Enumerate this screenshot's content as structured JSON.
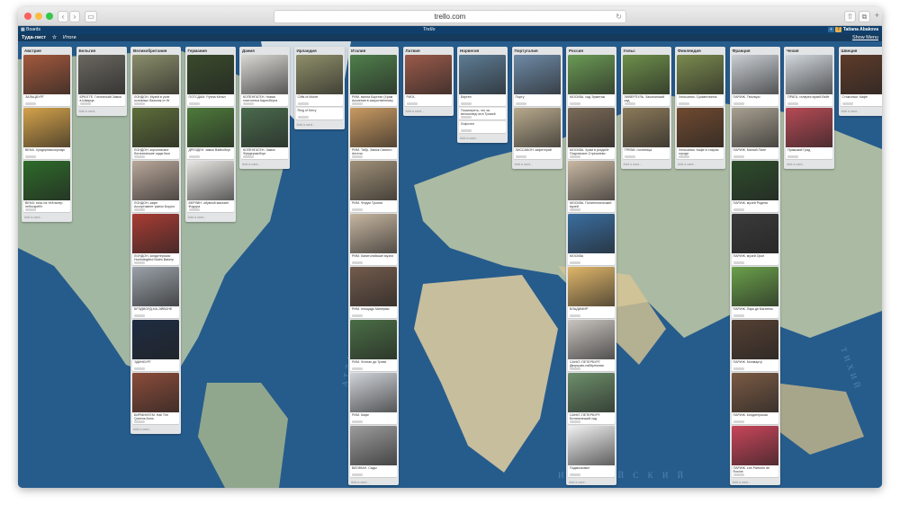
{
  "browser": {
    "url": "trello.com",
    "back_icon": "chevron-left",
    "forward_icon": "chevron-right"
  },
  "header": {
    "boards_label": "Boards",
    "logo": "Trello",
    "user_name": "Tatiana Abakova"
  },
  "board": {
    "title": "Туда-лист",
    "team_label": "Итоги",
    "show_menu": "Show Menu"
  },
  "add_card_label": "Add a card...",
  "lists": [
    {
      "title": "Австрия",
      "cards": [
        {
          "label": "ЗАЛЬЦБУРГ",
          "img": "#a3593d"
        },
        {
          "label": "ВЕНА. Хундертвассерхаус",
          "img": "#d4a24a"
        },
        {
          "label": "ВЕНА: ночь на «Кёльнер небоскрёб»",
          "img": "#2e6b2a"
        }
      ]
    },
    {
      "title": "Бельгия",
      "cards": [
        {
          "label": "БРЮГГЕ. Готический Замок в Шварце",
          "img": "#6a6760"
        }
      ]
    },
    {
      "title": "Великобритания",
      "cards": [
        {
          "label": "ЛОНДОН. Музей в узле основных базилик от W Дайвега",
          "img": "#8a8d6a"
        },
        {
          "label": "ЛОНДОН. королевские ботанические сады Кью",
          "img": "#5e6e3a"
        },
        {
          "label": "ЛОНДОН. кафе Ассортимент рынок Боруго",
          "img": "#b9a79a"
        },
        {
          "label": "ЛОНДОН. кондитерская Hummingbird Notes Bakery",
          "img": "#a83c34"
        },
        {
          "label": "БРЭДФОРД-НА-ЭЙВОНЕ",
          "img": "#9aa1a8"
        },
        {
          "label": "ЭДИНБУРГ",
          "img": "#1e2c42"
        },
        {
          "label": "БИРМИНГЕМ. Hall The Queens Arms",
          "img": "#8b4c3a"
        }
      ]
    },
    {
      "title": "Германия",
      "cards": [
        {
          "label": "ПОТСДАМ. Руина Кёльн",
          "img": "#3a4b2c"
        },
        {
          "label": "ДРЕЗДЕН. замок Вайнсберг",
          "img": "#4e7a3a"
        },
        {
          "label": "БЕРЛИН. обувной магазин Фодора",
          "img": "#e8e6e2"
        }
      ]
    },
    {
      "title": "Дания",
      "cards": [
        {
          "label": "КОПЕНГАГЕН. Новая глиптотека Карлсберга",
          "img": "#d9d7d2"
        },
        {
          "label": "КОПЕНГАГЕН. Замок Фредериксборг",
          "img": "#4a6b4d"
        }
      ]
    },
    {
      "title": "Ирландия",
      "cards": [
        {
          "label": "Cliffs of Moher",
          "img": "#8f8f6a"
        },
        {
          "label": "Ring of Kerry",
          "img": ""
        }
      ]
    },
    {
      "title": "Италия",
      "cards": [
        {
          "label": "РИМ. вилла Боргезе (Храм Асклепия в искусственном)",
          "img": "#4f7f4b"
        },
        {
          "label": "РИМ. Тибр. Замок Святого Ангела",
          "img": "#c99a62"
        },
        {
          "label": "РИМ. Форум Трояна",
          "img": "#a09078"
        },
        {
          "label": "РИМ. Капитолийские музеи",
          "img": "#c7b6a0"
        },
        {
          "label": "РИМ. площадь Минервы",
          "img": "#735b4c"
        },
        {
          "label": "РИМ. Фонтан ди Треви",
          "img": "#4a6e45"
        },
        {
          "label": "РИМ. Кафе",
          "img": "#cfd3d8"
        },
        {
          "label": "ВАТИКАН. Сады",
          "img": "#9c9c9c"
        }
      ]
    },
    {
      "title": "Латвия",
      "cards": [
        {
          "label": "РИГА",
          "img": "#9a5a4a"
        }
      ]
    },
    {
      "title": "Норвегия",
      "cards": [
        {
          "label": "Берген",
          "img": "#5d7c94"
        },
        {
          "label": "Посмотреть, что за велосипед на в Тромсё",
          "img": ""
        },
        {
          "label": "Лофотен",
          "img": ""
        }
      ]
    },
    {
      "title": "Португалия",
      "cards": [
        {
          "label": "Порту",
          "img": "#6e8aa6"
        },
        {
          "label": "ЛИССАБОН. кафетерий",
          "img": "#b7a98c"
        }
      ]
    },
    {
      "title": "Россия",
      "cards": [
        {
          "label": "МОСКВА. сад Эрмитаж",
          "img": "#6b9a54"
        },
        {
          "label": "МОСКВА. Храм в усадьбе Покровское-Стрешнево",
          "img": "#7b6a58"
        },
        {
          "label": "МОСКВА. Политехнический музей",
          "img": "#c9b8a3"
        },
        {
          "label": "МОСКВА",
          "img": "#3a6ea0"
        },
        {
          "label": "ВЛАДИМИР",
          "img": "#e0b66a"
        },
        {
          "label": "САНКТ-ПЕТЕРБУРГ. Дворцово-набережная",
          "img": "#c9c4bf"
        },
        {
          "label": "САНКТ-ПЕТЕРБУРГ. Ботанический сад",
          "img": "#6d8f6b"
        },
        {
          "label": "Подмосковье",
          "img": "#f2f2f2"
        }
      ]
    },
    {
      "title": "Уэльс",
      "cards": [
        {
          "label": "ЛИВЕРПУЛЬ. Заокеанский сад",
          "img": "#6d8f4a"
        },
        {
          "label": "ТРЕВИ. гостиница",
          "img": "#8b7a5a"
        }
      ]
    },
    {
      "title": "Финляндия",
      "cards": [
        {
          "label": "Хельсинки. Суоменлинна",
          "img": "#7a8a4e"
        },
        {
          "label": "Хельсинки. Кафе в старом городе",
          "img": "#704a30"
        }
      ]
    },
    {
      "title": "Франция",
      "cards": [
        {
          "label": "ПАРИЖ. Тюильри",
          "img": "#c9ced3"
        },
        {
          "label": "ПАРИЖ. Малый Пале",
          "img": "#a8a091"
        },
        {
          "label": "ПАРИЖ. музей Родена",
          "img": "#2e4d2c"
        },
        {
          "label": "ПАРИЖ. музей Орсе",
          "img": "#3a3a3a"
        },
        {
          "label": "ПАРИЖ. Парк де Багатель",
          "img": "#6aa04a"
        },
        {
          "label": "ПАРИЖ. Монмартр",
          "img": "#554033"
        },
        {
          "label": "ПАРИЖ. Кондитерская",
          "img": "#7a5a44"
        },
        {
          "label": "ПАРИЖ. Les Parfums de Rosine",
          "img": "#c9455a"
        }
      ]
    },
    {
      "title": "Чехия",
      "cards": [
        {
          "label": "ПРАГА. галерея музей Вейт",
          "img": "#d0d6dc"
        },
        {
          "label": "Пражский Град",
          "img": "#b64a55"
        }
      ]
    },
    {
      "title": "Швеция",
      "cards": [
        {
          "label": "Стокгольм. Кафе",
          "img": "#5e3b2a"
        }
      ]
    }
  ]
}
